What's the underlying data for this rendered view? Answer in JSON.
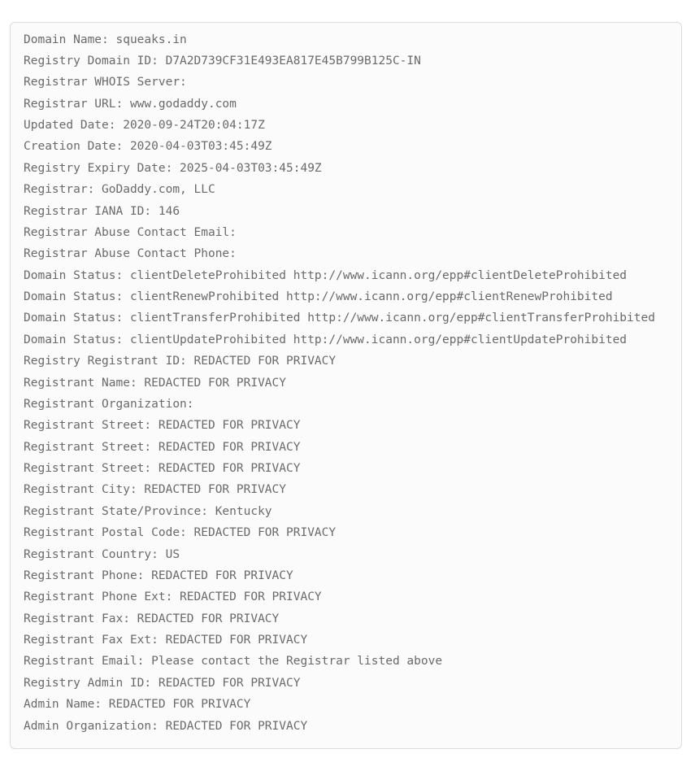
{
  "whois": {
    "lines": [
      "Domain Name: squeaks.in",
      "Registry Domain ID: D7A2D739CF31E493EA817E45B799B125C-IN",
      "Registrar WHOIS Server:",
      "Registrar URL: www.godaddy.com",
      "Updated Date: 2020-09-24T20:04:17Z",
      "Creation Date: 2020-04-03T03:45:49Z",
      "Registry Expiry Date: 2025-04-03T03:45:49Z",
      "Registrar: GoDaddy.com, LLC",
      "Registrar IANA ID: 146",
      "Registrar Abuse Contact Email:",
      "Registrar Abuse Contact Phone:",
      "Domain Status: clientDeleteProhibited http://www.icann.org/epp#clientDeleteProhibited",
      "Domain Status: clientRenewProhibited http://www.icann.org/epp#clientRenewProhibited",
      "Domain Status: clientTransferProhibited http://www.icann.org/epp#clientTransferProhibited",
      "Domain Status: clientUpdateProhibited http://www.icann.org/epp#clientUpdateProhibited",
      "Registry Registrant ID: REDACTED FOR PRIVACY",
      "Registrant Name: REDACTED FOR PRIVACY",
      "Registrant Organization:",
      "Registrant Street: REDACTED FOR PRIVACY",
      "Registrant Street: REDACTED FOR PRIVACY",
      "Registrant Street: REDACTED FOR PRIVACY",
      "Registrant City: REDACTED FOR PRIVACY",
      "Registrant State/Province: Kentucky",
      "Registrant Postal Code: REDACTED FOR PRIVACY",
      "Registrant Country: US",
      "Registrant Phone: REDACTED FOR PRIVACY",
      "Registrant Phone Ext: REDACTED FOR PRIVACY",
      "Registrant Fax: REDACTED FOR PRIVACY",
      "Registrant Fax Ext: REDACTED FOR PRIVACY",
      "Registrant Email: Please contact the Registrar listed above",
      "Registry Admin ID: REDACTED FOR PRIVACY",
      "Admin Name: REDACTED FOR PRIVACY",
      "Admin Organization: REDACTED FOR PRIVACY"
    ]
  }
}
